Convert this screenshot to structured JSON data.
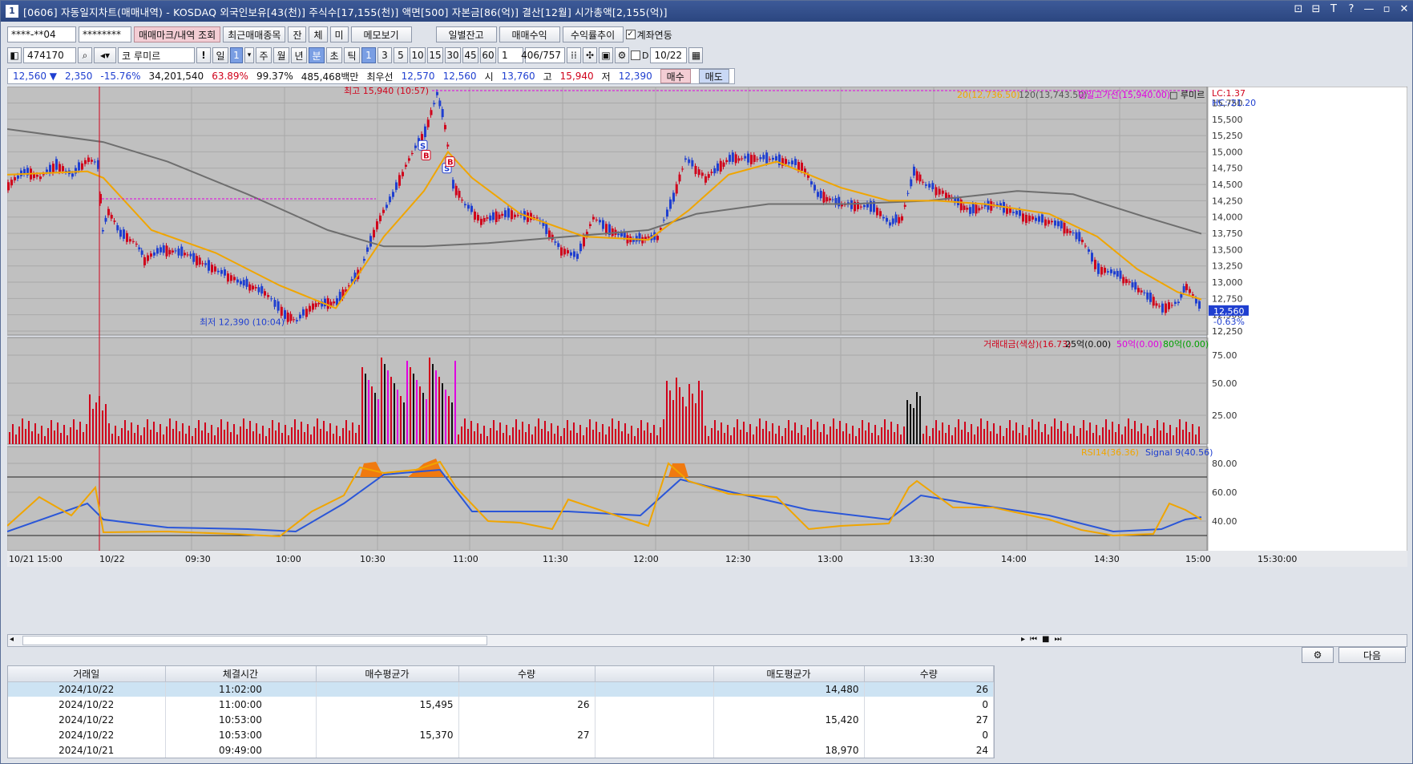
{
  "window": {
    "number": "1",
    "title": "[0606] 자동일지차트(매매내역) - KOSDAQ 외국인보유[43(천)] 주식수[17,155(천)] 액면[500] 자본금[86(억)] 결산[12월] 시가총액[2,155(억)]",
    "controls": [
      "⊡",
      "⊟",
      "T",
      "?",
      "—",
      "▫",
      "✕"
    ]
  },
  "toolbar1": {
    "account": "****-**04",
    "password": "********",
    "trade_mark_btn": "매매마크/내역 조회",
    "recent_btn": "최근매매종목",
    "jan": "잔",
    "che": "체",
    "mi": "미",
    "memo_btn": "메모보기",
    "daily_btn": "일별잔고",
    "profit_btn": "매매수익",
    "trend_btn": "수익률추이",
    "link_label": "계좌연동"
  },
  "toolbar2": {
    "code": "474170",
    "market": "코",
    "name": "루미르",
    "period_unit": "일",
    "period_val": "1",
    "tabs": [
      "주",
      "월",
      "년",
      "분",
      "초",
      "틱"
    ],
    "minute_opts": [
      "1",
      "3",
      "5",
      "10",
      "15",
      "30",
      "45",
      "60"
    ],
    "count": "1",
    "range": "406/757",
    "date": "10/22"
  },
  "quote": {
    "price": "12,560 ▼",
    "change": "2,350",
    "rate": "-15.76%",
    "volume": "34,201,540",
    "r1": "63.89%",
    "r2": "99.37%",
    "amount": "485,468백만",
    "best_label": "최우선",
    "ask": "12,570",
    "bid": "12,560",
    "open_label": "시",
    "open": "13,760",
    "high_label": "고",
    "high": "15,940",
    "low_label": "저",
    "low": "12,390",
    "buy_btn": "매수",
    "sell_btn": "매도"
  },
  "legend": {
    "ma20": "20(12,736.50)",
    "ma120": "120(13,743.50)",
    "high_line": "당일고가선(15,940.00)",
    "symbol": "□ 루미르",
    "lc": "LC:1.37",
    "hc": "HC:-21.20",
    "vol_title": "거래대금(색상)(16.73)",
    "vol_25": "25억(0.00)",
    "vol_50": "50억(0.00)",
    "vol_80": "80억(0.00)",
    "rsi": "RSI14(36.36)",
    "signal": "Signal 9(40.56)"
  },
  "annotations": {
    "high": "최고 15,940 (10:57)",
    "low": "최저 12,390 (10:04)",
    "last_price": "12,560",
    "last_rate": "-0.63%"
  },
  "price_axis": [
    "15,750",
    "15,500",
    "15,250",
    "15,000",
    "14,750",
    "14,500",
    "14,250",
    "14,000",
    "13,750",
    "13,500",
    "13,250",
    "13,000",
    "12,750",
    "12,500",
    "12,250"
  ],
  "vol_axis": [
    "75.00",
    "50.00",
    "25.00"
  ],
  "rsi_axis": [
    "80.00",
    "60.00",
    "40.00"
  ],
  "time_axis": [
    "10/21 15:00",
    "10/22",
    "09:30",
    "10:00",
    "10:30",
    "11:00",
    "11:30",
    "12:00",
    "12:30",
    "13:00",
    "13:30",
    "14:00",
    "14:30",
    "15:00",
    "15:30:00"
  ],
  "chart_data": {
    "type": "candlestick",
    "price_range": [
      12250,
      15940
    ],
    "high": 15940,
    "low": 12390,
    "last": 12560,
    "ma20_last": 12736.5,
    "ma120_last": 13743.5,
    "rsi_last": 36.36,
    "signal_last": 40.56
  },
  "table": {
    "headers": [
      "거래일",
      "체결시간",
      "매수평균가",
      "수량",
      "",
      "매도평균가",
      "수량"
    ],
    "rows": [
      [
        "2024/10/22",
        "11:02:00",
        "",
        "",
        "",
        "14,480",
        "26"
      ],
      [
        "2024/10/22",
        "11:00:00",
        "15,495",
        "26",
        "",
        "",
        "0"
      ],
      [
        "2024/10/22",
        "10:53:00",
        "",
        "",
        "",
        "15,420",
        "27"
      ],
      [
        "2024/10/22",
        "10:53:00",
        "15,370",
        "27",
        "",
        "",
        "0"
      ],
      [
        "2024/10/21",
        "09:49:00",
        "",
        "",
        "",
        "18,970",
        "24"
      ]
    ]
  },
  "next_btn": "다음",
  "colors": {
    "up": "#d0021b",
    "down": "#1f3fd0",
    "ma20": "#f0a500",
    "ma120": "#666666",
    "magenta": "#e000e0"
  }
}
